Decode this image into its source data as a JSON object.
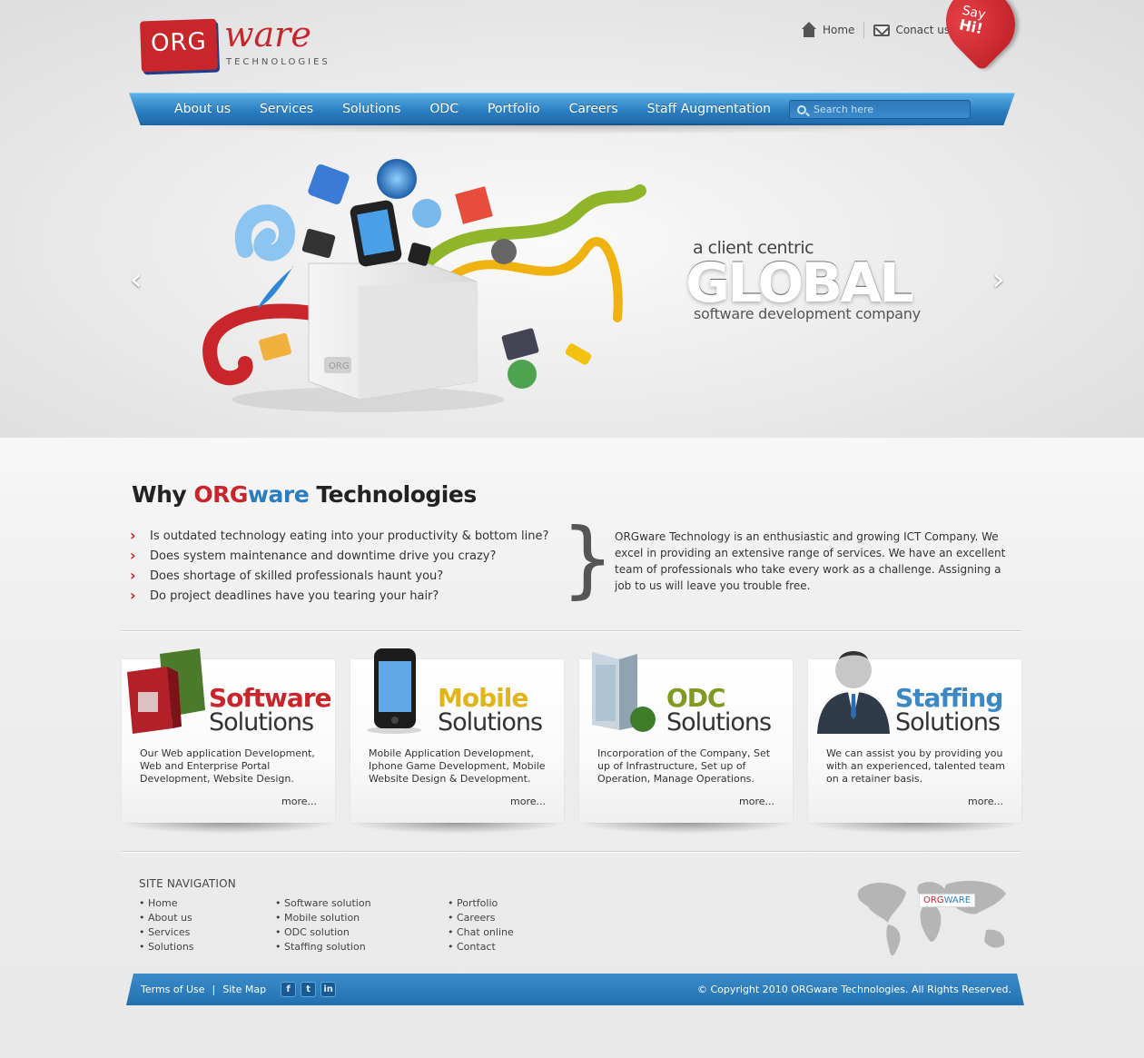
{
  "header": {
    "logo": {
      "org": "ORG",
      "ware": "ware",
      "tagline": "TECHNOLOGIES"
    },
    "top_links": [
      {
        "label": "Home",
        "icon": "home-icon"
      },
      {
        "label": "Conact us",
        "icon": "mail-icon"
      }
    ],
    "say_hi": {
      "line1": "Say",
      "line2": "Hi!"
    }
  },
  "nav": {
    "items": [
      "About us",
      "Services",
      "Solutions",
      "ODC",
      "Portfolio",
      "Careers",
      "Staff Augmentation"
    ],
    "search_placeholder": "Search here"
  },
  "hero": {
    "prev_glyph": "‹",
    "next_glyph": "›",
    "box_label": "ORG",
    "tagline_small": "a client centric",
    "tagline_big": "GLOBAL",
    "tagline_sub": "software development company"
  },
  "why": {
    "title_prefix": "Why ",
    "title_org": "ORG",
    "title_ware": "ware",
    "title_suffix": " Technologies",
    "questions": [
      "Is outdated technology eating into your productivity & bottom line?",
      "Does system maintenance and downtime drive you crazy?",
      "Does shortage of skilled professionals haunt you?",
      "Do project deadlines have you tearing your hair?"
    ],
    "brace": "}",
    "description": "ORGware Technology is an enthusiastic and growing ICT Company. We excel in providing an extensive range of services. We have an excellent team of professionals who take every work as a challenge. Assigning a job to us will leave you trouble free."
  },
  "services": [
    {
      "title": "Software",
      "subtitle": "Solutions",
      "color": "#c8262b",
      "icon": "product-box-icon",
      "description": "Our Web application Development, Web and Enterprise Portal Development, Website Design.",
      "more": "more..."
    },
    {
      "title": "Mobile",
      "subtitle": "Solutions",
      "color": "#e0b51b",
      "icon": "smartphone-icon",
      "description": "Mobile Application Development, Iphone Game Development, Mobile Website Design & Development.",
      "more": "more..."
    },
    {
      "title": "ODC",
      "subtitle": "Solutions",
      "color": "#7e9a22",
      "icon": "office-building-icon",
      "description": "Incorporation of the Company, Set up of Infrastructure, Set up of Operation, Manage Operations.",
      "more": "more..."
    },
    {
      "title": "Staffing",
      "subtitle": "Solutions",
      "color": "#3b88c4",
      "icon": "businessman-icon",
      "description": "We can assist you by providing you with an experienced, talented team on a retainer basis.",
      "more": "more..."
    }
  ],
  "footer": {
    "nav_title": "SITE NAVIGATION",
    "col1": [
      "Home",
      "About us",
      "Services",
      "Solutions"
    ],
    "col2": [
      "Software solution",
      "Mobile solution",
      "ODC solution",
      "Staffing solution"
    ],
    "col3": [
      "Portfolio",
      "Careers",
      "Chat online",
      "Contact"
    ],
    "map_badge": {
      "org": "ORG",
      "ware": "WARE"
    },
    "terms": "Terms of Use",
    "sitemap": "Site Map",
    "pipe": "|",
    "social": [
      {
        "icon": "facebook-icon",
        "glyph": "f"
      },
      {
        "icon": "twitter-icon",
        "glyph": "t"
      },
      {
        "icon": "linkedin-icon",
        "glyph": "in"
      }
    ],
    "copyright": "© Copyright 2010  ORGware Technologies. All Rights Reserved."
  },
  "colors": {
    "brand_red": "#c8262b",
    "brand_blue": "#2a7dc0"
  }
}
